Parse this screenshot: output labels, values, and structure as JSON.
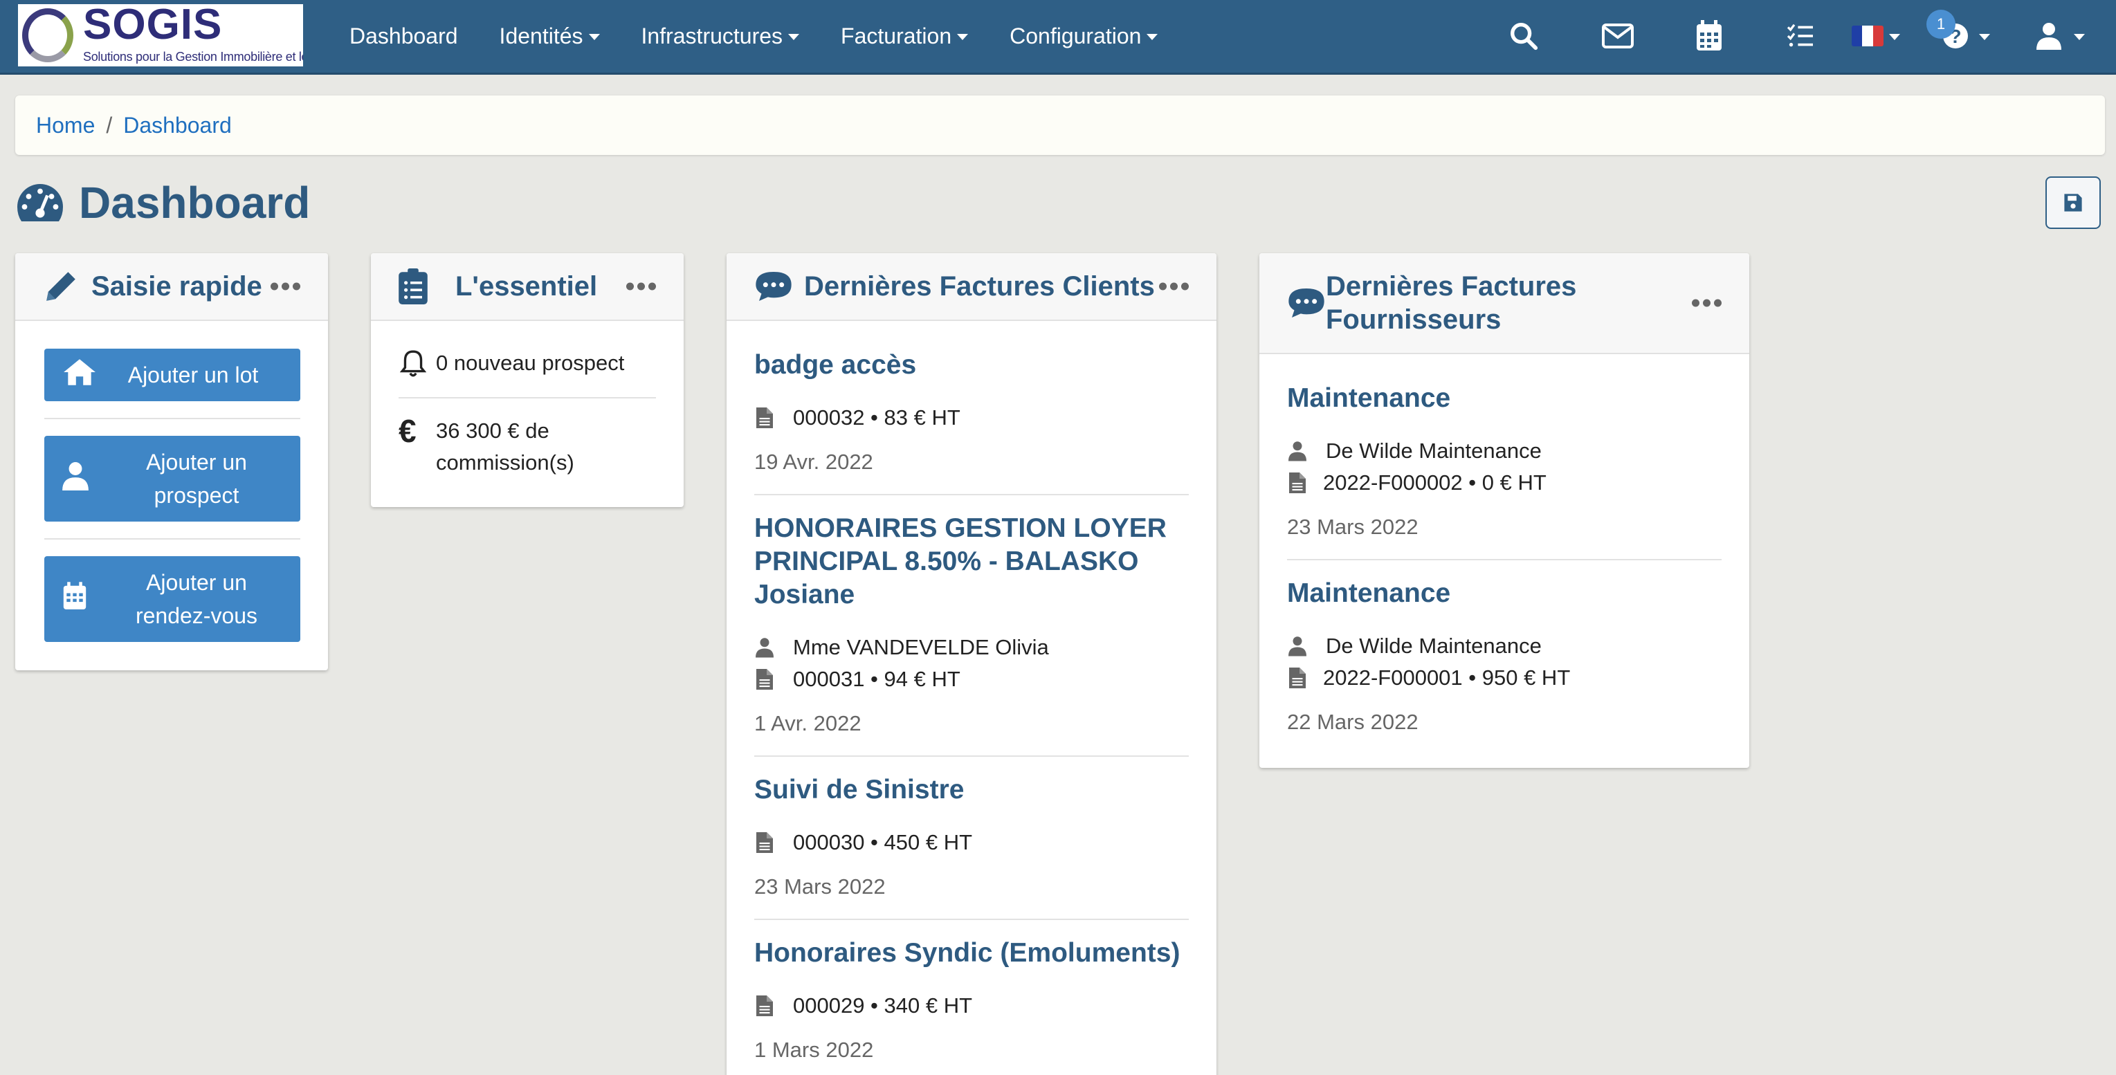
{
  "navbar": {
    "logo_text": "SOGIS",
    "logo_subtitle": "Solutions pour la Gestion Immobilière et le Syndic",
    "menu": [
      {
        "label": "Dashboard",
        "dropdown": false
      },
      {
        "label": "Identités",
        "dropdown": true
      },
      {
        "label": "Infrastructures",
        "dropdown": true
      },
      {
        "label": "Facturation",
        "dropdown": true
      },
      {
        "label": "Configuration",
        "dropdown": true
      }
    ],
    "icons": [
      "search-icon",
      "envelope-icon",
      "calendar-icon",
      "tasks-icon",
      "french-flag-icon",
      "help-icon",
      "user-icon"
    ],
    "notification_count": "1"
  },
  "breadcrumb": {
    "home": "Home",
    "separator": "/",
    "current": "Dashboard"
  },
  "page": {
    "title": "Dashboard"
  },
  "saisie_rapide": {
    "title": "Saisie rapide",
    "buttons": [
      {
        "label": "Ajouter un lot",
        "icon": "home-icon"
      },
      {
        "label": "Ajouter un prospect",
        "icon": "user-icon"
      },
      {
        "label": "Ajouter un rendez-vous",
        "icon": "calendar-icon"
      }
    ]
  },
  "essentiel": {
    "title": "L'essentiel",
    "items": [
      {
        "icon": "bell-icon",
        "text": "0 nouveau prospect"
      },
      {
        "icon": "euro-icon",
        "text": "36 300 € de commission(s)"
      }
    ]
  },
  "factures_clients": {
    "title": "Dernières Factures Clients",
    "items": [
      {
        "title": "badge accès",
        "client": "",
        "invoice": "000032 • 83 € HT",
        "date": "19 Avr. 2022"
      },
      {
        "title": "HONORAIRES GESTION LOYER PRINCIPAL 8.50% - BALASKO Josiane",
        "client": "Mme VANDEVELDE Olivia",
        "invoice": "000031 • 94 € HT",
        "date": "1 Avr. 2022"
      },
      {
        "title": "Suivi de Sinistre",
        "client": "",
        "invoice": "000030 • 450 € HT",
        "date": "23 Mars 2022"
      },
      {
        "title": "Honoraires Syndic (Emoluments)",
        "client": "",
        "invoice": "000029 • 340 € HT",
        "date": "1 Mars 2022"
      }
    ]
  },
  "factures_fournisseurs": {
    "title": "Dernières Factures Fournisseurs",
    "items": [
      {
        "title": "Maintenance",
        "supplier": "De Wilde Maintenance",
        "invoice": "2022-F000002 • 0 € HT",
        "date": "23 Mars 2022"
      },
      {
        "title": "Maintenance",
        "supplier": "De Wilde Maintenance",
        "invoice": "2022-F000001 • 950 € HT",
        "date": "22 Mars 2022"
      }
    ]
  }
}
